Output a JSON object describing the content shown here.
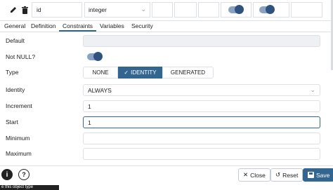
{
  "row": {
    "name_value": "id",
    "type_value": "integer",
    "notnull_toggle_on": true,
    "pk_toggle_on": true
  },
  "tabs": [
    "General",
    "Definition",
    "Constraints",
    "Variables",
    "Security"
  ],
  "active_tab": "Constraints",
  "form": {
    "default_label": "Default",
    "default_value": "",
    "notnull_label": "Not NULL?",
    "notnull_on": true,
    "type_label": "Type",
    "type_options": [
      "NONE",
      "IDENTITY",
      "GENERATED"
    ],
    "type_selected": "IDENTITY",
    "identity_label": "Identity",
    "identity_value": "ALWAYS",
    "increment_label": "Increment",
    "increment_value": "1",
    "start_label": "Start",
    "start_value": "1",
    "minimum_label": "Minimum",
    "minimum_value": "",
    "maximum_label": "Maximum",
    "maximum_value": ""
  },
  "footer": {
    "info_glyph": "i",
    "help_glyph": "?",
    "close_label": "Close",
    "reset_label": "Reset",
    "save_label": "Save",
    "tooltip_text": "e this object type"
  },
  "colors": {
    "accent": "#326690",
    "border": "#dde0e6",
    "disabled_bg": "#eef0f3"
  }
}
